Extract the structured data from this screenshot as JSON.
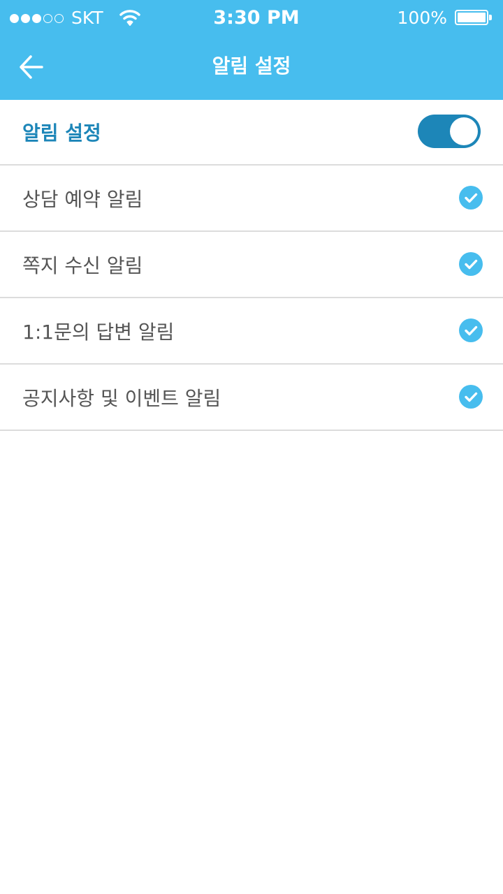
{
  "status_bar": {
    "carrier": "SKT",
    "signal_filled": 3,
    "signal_total": 5,
    "time": "3:30 PM",
    "battery_percent": "100%",
    "battery_level": 1.0
  },
  "nav": {
    "title": "알림 설정",
    "back_icon": "arrow-left-icon"
  },
  "settings": {
    "master": {
      "label": "알림 설정",
      "enabled": true
    },
    "items": [
      {
        "label": "상담 예약 알림",
        "checked": true
      },
      {
        "label": "쪽지 수신 알림",
        "checked": true
      },
      {
        "label": "1:1문의 답변 알림",
        "checked": true
      },
      {
        "label": "공지사항 및 이벤트 알림",
        "checked": true
      }
    ]
  },
  "colors": {
    "header": "#47bdee",
    "accent_dark": "#1d86b8",
    "check": "#47bdee",
    "divider": "#dcdcdc",
    "text": "#555555"
  },
  "icons": {
    "wifi": "wifi-icon",
    "battery": "battery-icon",
    "check": "checkmark-circle-icon"
  }
}
